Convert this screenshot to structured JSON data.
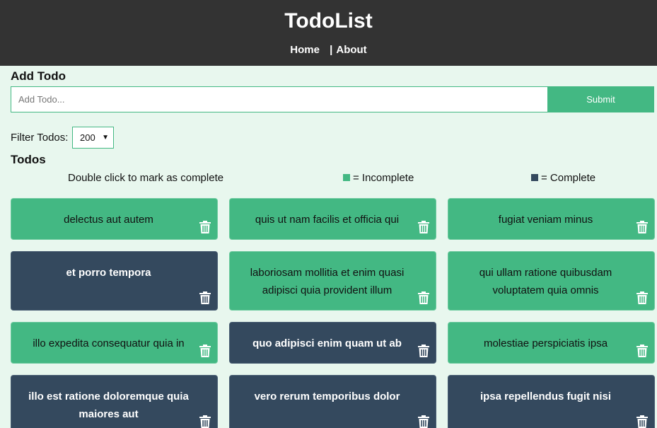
{
  "header": {
    "title": "TodoList",
    "nav": {
      "home": "Home",
      "separator": "|",
      "about": "About"
    }
  },
  "add_todo": {
    "title": "Add Todo",
    "placeholder": "Add Todo...",
    "submit_label": "Submit"
  },
  "filter": {
    "label": "Filter Todos:",
    "selected": "200"
  },
  "todos_section": {
    "title": "Todos",
    "hint": "Double click to mark as complete",
    "legend": [
      {
        "label": "= Incomplete",
        "color": "#43b883"
      },
      {
        "label": "= Complete",
        "color": "#34495e"
      }
    ]
  },
  "colors": {
    "accent": "#43b883",
    "complete": "#34495e",
    "header_bg": "#333333",
    "page_bg": "#e8f7ee"
  },
  "todos": [
    {
      "title": "delectus aut autem",
      "completed": false
    },
    {
      "title": "quis ut nam facilis et officia qui",
      "completed": false
    },
    {
      "title": "fugiat veniam minus",
      "completed": false
    },
    {
      "title": "et porro tempora",
      "completed": true
    },
    {
      "title": "laboriosam mollitia et enim quasi adipisci quia provident illum",
      "completed": false
    },
    {
      "title": "qui ullam ratione quibusdam voluptatem quia omnis",
      "completed": false
    },
    {
      "title": "illo expedita consequatur quia in",
      "completed": false
    },
    {
      "title": "quo adipisci enim quam ut ab",
      "completed": true
    },
    {
      "title": "molestiae perspiciatis ipsa",
      "completed": false
    },
    {
      "title": "illo est ratione doloremque quia maiores aut",
      "completed": true
    },
    {
      "title": "vero rerum temporibus dolor",
      "completed": true
    },
    {
      "title": "ipsa repellendus fugit nisi",
      "completed": true
    }
  ]
}
